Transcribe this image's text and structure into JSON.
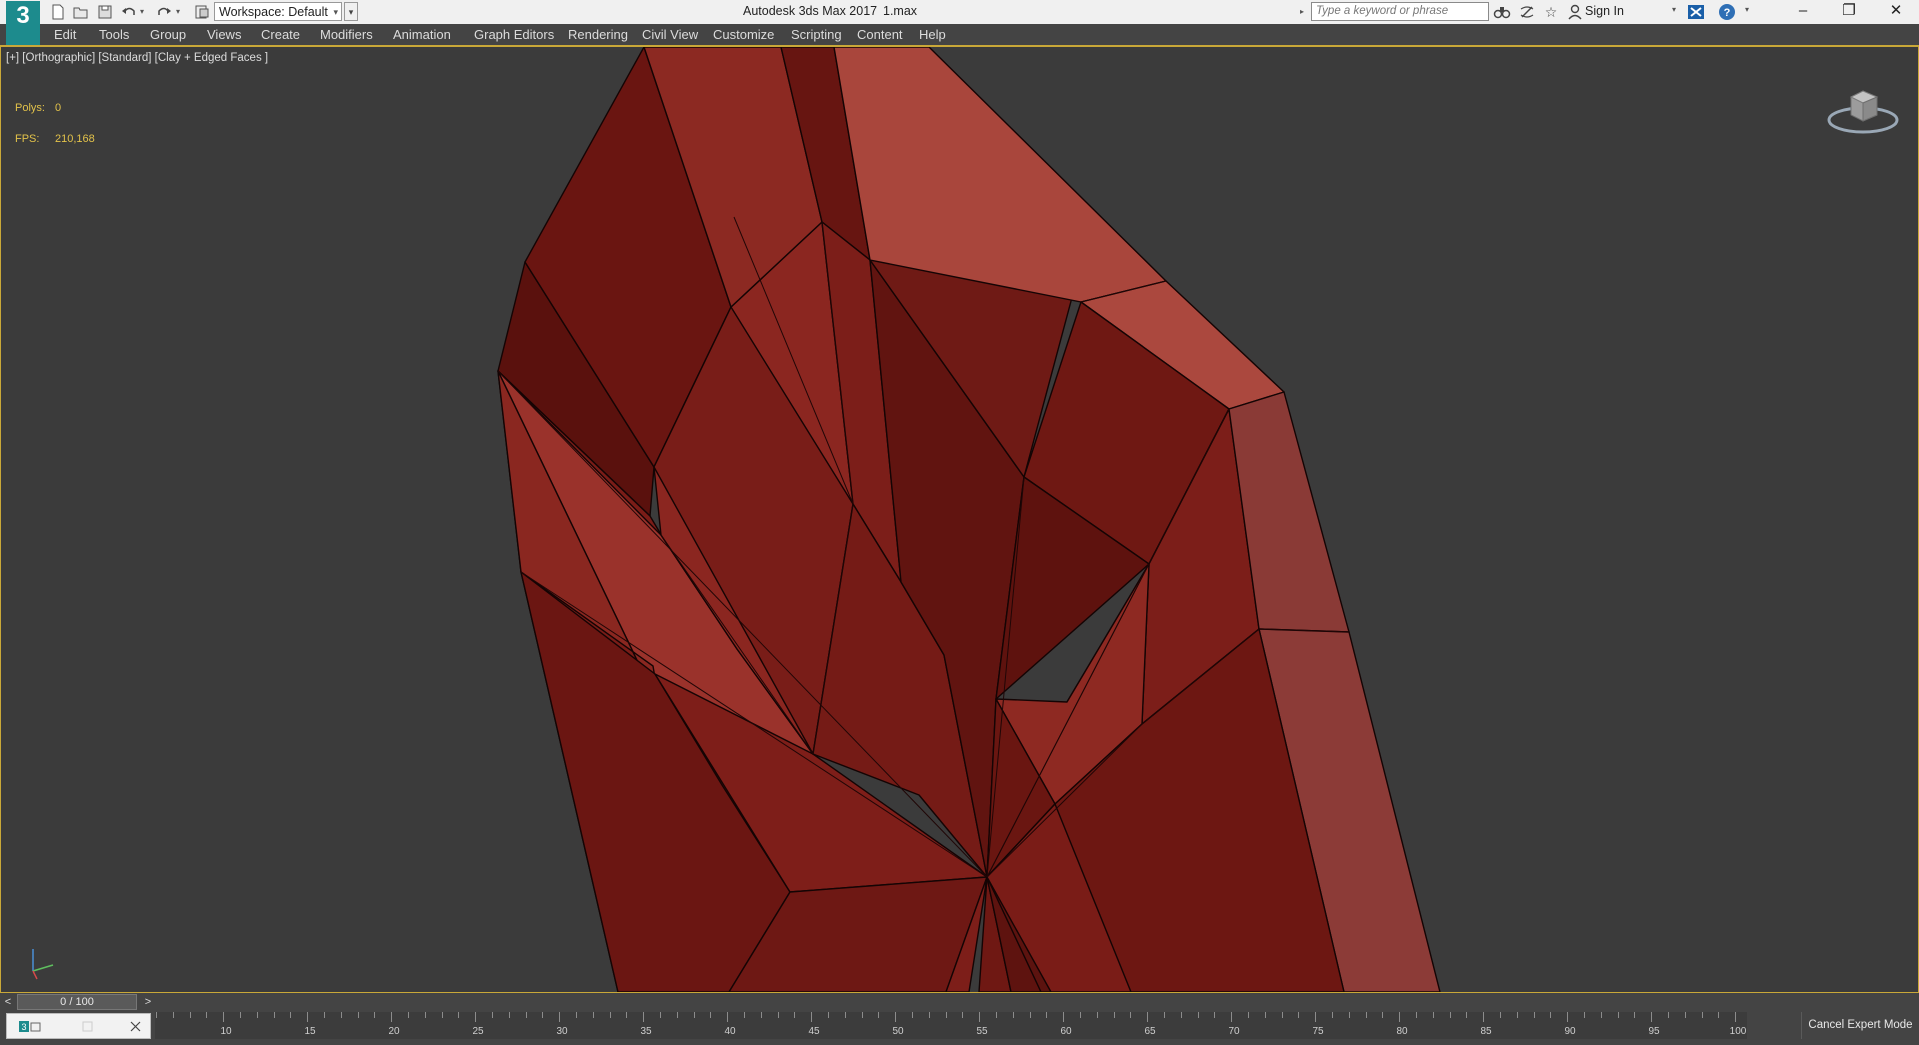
{
  "app": {
    "logo_text": "3",
    "title": "Autodesk 3ds Max 2017",
    "file_name": "1.max"
  },
  "quick_access": {
    "workspace_label": "Workspace: Default",
    "icons": [
      "new-file-icon",
      "open-file-icon",
      "save-icon",
      "undo-icon",
      "redo-icon",
      "project-folder-icon"
    ]
  },
  "search": {
    "placeholder": "Type a keyword or phrase"
  },
  "infocenter": {
    "sign_in_label": "Sign In"
  },
  "window_controls": [
    "minimize",
    "restore",
    "close"
  ],
  "menu": {
    "items": [
      "Edit",
      "Tools",
      "Group",
      "Views",
      "Create",
      "Modifiers",
      "Animation",
      "Graph Editors",
      "Rendering",
      "Civil View",
      "Customize",
      "Scripting",
      "Content",
      "Help"
    ]
  },
  "viewport": {
    "label": "[+] [Orthographic] [Standard] [Clay + Edged Faces ]",
    "stats": {
      "polys_label": "Polys:",
      "polys_value": "0",
      "fps_label": "FPS:",
      "fps_value": "210,168"
    },
    "model_color": "#7a1c17",
    "background_color": "#3b3b3b"
  },
  "timeline": {
    "frame_readout": "0 / 100",
    "prev_label": "<",
    "next_label": ">",
    "ruler_labels": [
      "10",
      "15",
      "20",
      "25",
      "30",
      "35",
      "40",
      "45",
      "50",
      "55",
      "60",
      "65",
      "70",
      "75",
      "80",
      "85",
      "90",
      "95",
      "100"
    ]
  },
  "status": {
    "cancel_expert_label": "Cancel Expert Mode"
  }
}
